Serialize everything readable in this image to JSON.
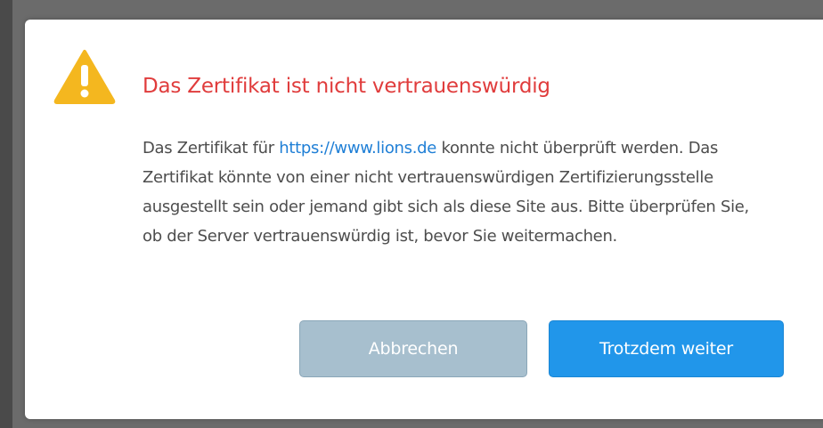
{
  "dialog": {
    "title": "Das Zertifikat ist nicht vertrauenswürdig",
    "message": {
      "before_link": "Das Zertifikat für ",
      "link_text": "https://www.lions.de",
      "after_link": " konnte nicht überprüft werden. Das Zertifikat könnte von einer nicht vertrauenswürdigen Zertifizierungsstelle ausgestellt sein oder jemand gibt sich als diese Site aus. Bitte überprüfen Sie, ob der Server vertrauenswürdig ist, bevor Sie weitermachen."
    },
    "buttons": {
      "cancel_label": "Abbrechen",
      "continue_label": "Trotzdem weiter"
    },
    "icon": "warning-icon"
  },
  "colors": {
    "title": "#e03c3c",
    "link": "#1f7fd6",
    "warning": "#f4b71f",
    "cancel_button": "#a7bfce",
    "continue_button": "#2196ea",
    "backdrop": "#6b6b6b"
  }
}
